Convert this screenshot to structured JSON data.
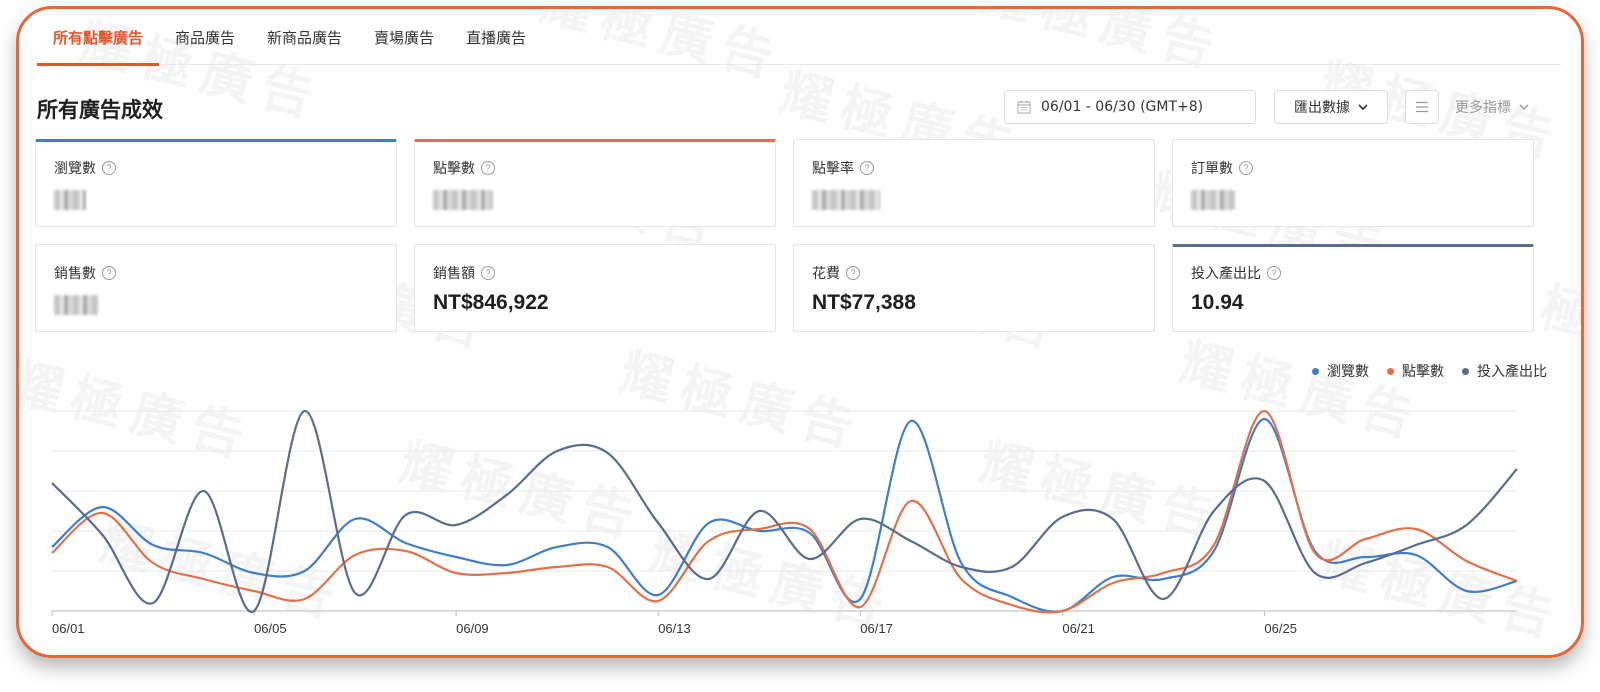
{
  "tabs": [
    {
      "label": "所有點擊廣告",
      "active": true
    },
    {
      "label": "商品廣告",
      "active": false
    },
    {
      "label": "新商品廣告",
      "active": false
    },
    {
      "label": "賣場廣告",
      "active": false
    },
    {
      "label": "直播廣告",
      "active": false
    }
  ],
  "page_title": "所有廣告成效",
  "toolbar": {
    "date_range": "06/01 - 06/30 (GMT+8)",
    "export_label": "匯出數據",
    "more_metrics_label": "更多指標"
  },
  "metrics": [
    {
      "label": "瀏覽數",
      "value": "",
      "obscured": true,
      "selected": "blue"
    },
    {
      "label": "點擊數",
      "value": "",
      "obscured": true,
      "selected": "orange"
    },
    {
      "label": "點擊率",
      "value": "",
      "obscured": true,
      "selected": null
    },
    {
      "label": "訂單數",
      "value": "",
      "obscured": true,
      "selected": null
    },
    {
      "label": "銷售數",
      "value": "",
      "obscured": true,
      "selected": null
    },
    {
      "label": "銷售額",
      "value": "NT$846,922",
      "obscured": false,
      "selected": null
    },
    {
      "label": "花費",
      "value": "NT$77,388",
      "obscured": false,
      "selected": null
    },
    {
      "label": "投入產出比",
      "value": "10.94",
      "obscured": false,
      "selected": "navy"
    }
  ],
  "watermark_text": "耀極廣告",
  "colors": {
    "accent": "#e4572e",
    "frame": "#e4683a",
    "views": "#3f7ec6",
    "clicks": "#e0714a",
    "roas": "#5b6b8e"
  },
  "chart_data": {
    "type": "line",
    "x": [
      "06/01",
      "06/02",
      "06/03",
      "06/04",
      "06/05",
      "06/06",
      "06/07",
      "06/08",
      "06/09",
      "06/10",
      "06/11",
      "06/12",
      "06/13",
      "06/14",
      "06/15",
      "06/16",
      "06/17",
      "06/18",
      "06/19",
      "06/20",
      "06/21",
      "06/22",
      "06/23",
      "06/24",
      "06/25",
      "06/26",
      "06/27",
      "06/28",
      "06/29",
      "06/30"
    ],
    "x_ticks": [
      "06/01",
      "06/05",
      "06/09",
      "06/13",
      "06/17",
      "06/21",
      "06/25"
    ],
    "ylim": [
      0,
      100
    ],
    "grid": true,
    "legend_position": "top-right",
    "series": [
      {
        "name": "瀏覽數",
        "color": "#3f7ec6",
        "values": [
          32,
          52,
          33,
          29,
          19,
          20,
          46,
          34,
          27,
          23,
          32,
          32,
          8,
          44,
          40,
          39,
          6,
          95,
          24,
          7,
          0,
          17,
          16,
          30,
          96,
          30,
          27,
          28,
          10,
          15
        ]
      },
      {
        "name": "點擊數",
        "color": "#e0714a",
        "values": [
          29,
          49,
          24,
          16,
          10,
          6,
          28,
          30,
          19,
          19,
          22,
          22,
          5,
          35,
          41,
          41,
          2,
          55,
          16,
          3,
          0,
          14,
          19,
          33,
          100,
          29,
          36,
          41,
          25,
          15
        ]
      },
      {
        "name": "投入產出比",
        "color": "#5b6b8e",
        "values": [
          64,
          38,
          4,
          60,
          0,
          100,
          9,
          48,
          43,
          58,
          80,
          79,
          44,
          16,
          50,
          26,
          46,
          35,
          22,
          22,
          47,
          46,
          6,
          50,
          65,
          19,
          24,
          33,
          43,
          71
        ]
      }
    ]
  }
}
